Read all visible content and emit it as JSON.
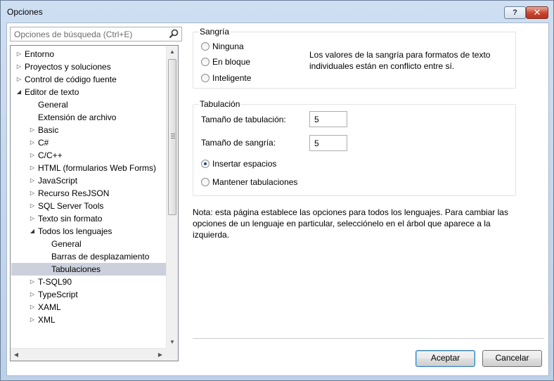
{
  "window": {
    "title": "Opciones",
    "help_label": "?",
    "close_label": "✕"
  },
  "search": {
    "placeholder": "Opciones de búsqueda (Ctrl+E)"
  },
  "tree": {
    "items": [
      {
        "label": "Entorno",
        "level": 0,
        "expander": "collapsed"
      },
      {
        "label": "Proyectos y soluciones",
        "level": 0,
        "expander": "collapsed"
      },
      {
        "label": "Control de código fuente",
        "level": 0,
        "expander": "collapsed"
      },
      {
        "label": "Editor de texto",
        "level": 0,
        "expander": "expanded"
      },
      {
        "label": "General",
        "level": 1,
        "expander": "none"
      },
      {
        "label": "Extensión de archivo",
        "level": 1,
        "expander": "none"
      },
      {
        "label": "Basic",
        "level": 1,
        "expander": "collapsed"
      },
      {
        "label": "C#",
        "level": 1,
        "expander": "collapsed"
      },
      {
        "label": "C/C++",
        "level": 1,
        "expander": "collapsed"
      },
      {
        "label": "HTML (formularios Web Forms)",
        "level": 1,
        "expander": "collapsed"
      },
      {
        "label": "JavaScript",
        "level": 1,
        "expander": "collapsed"
      },
      {
        "label": "Recurso ResJSON",
        "level": 1,
        "expander": "collapsed"
      },
      {
        "label": "SQL Server Tools",
        "level": 1,
        "expander": "collapsed"
      },
      {
        "label": "Texto sin formato",
        "level": 1,
        "expander": "collapsed"
      },
      {
        "label": "Todos los lenguajes",
        "level": 1,
        "expander": "expanded"
      },
      {
        "label": "General",
        "level": 2,
        "expander": "none"
      },
      {
        "label": "Barras de desplazamiento",
        "level": 2,
        "expander": "none"
      },
      {
        "label": "Tabulaciones",
        "level": 2,
        "expander": "none",
        "selected": true
      },
      {
        "label": "T-SQL90",
        "level": 1,
        "expander": "collapsed"
      },
      {
        "label": "TypeScript",
        "level": 1,
        "expander": "collapsed"
      },
      {
        "label": "XAML",
        "level": 1,
        "expander": "collapsed"
      },
      {
        "label": "XML",
        "level": 1,
        "expander": "collapsed"
      }
    ]
  },
  "indent": {
    "title": "Sangría",
    "options": [
      "Ninguna",
      "En bloque",
      "Inteligente"
    ],
    "selected": null,
    "message": [
      "Los valores de la sangría para formatos de texto",
      "individuales están en conflicto entre sí."
    ]
  },
  "tabs": {
    "title": "Tabulación",
    "tab_size_label": "Tamaño de tabulación:",
    "tab_size_value": "5",
    "indent_size_label": "Tamaño de sangría:",
    "indent_size_value": "5",
    "insert_spaces_label": "Insertar espacios",
    "keep_tabs_label": "Mantener tabulaciones",
    "selected": "insert_spaces"
  },
  "note": [
    "Nota: esta página establece las opciones para todos los lenguajes. Para cambiar las",
    "opciones de un lenguaje en particular, selecciónelo en el árbol que aparece a la",
    "izquierda."
  ],
  "buttons": {
    "ok": "Aceptar",
    "cancel": "Cancelar"
  },
  "colors": {
    "selection": "#ccd0dc",
    "radio_dot": "#1a4b7d",
    "close_button": "#c8432e"
  }
}
